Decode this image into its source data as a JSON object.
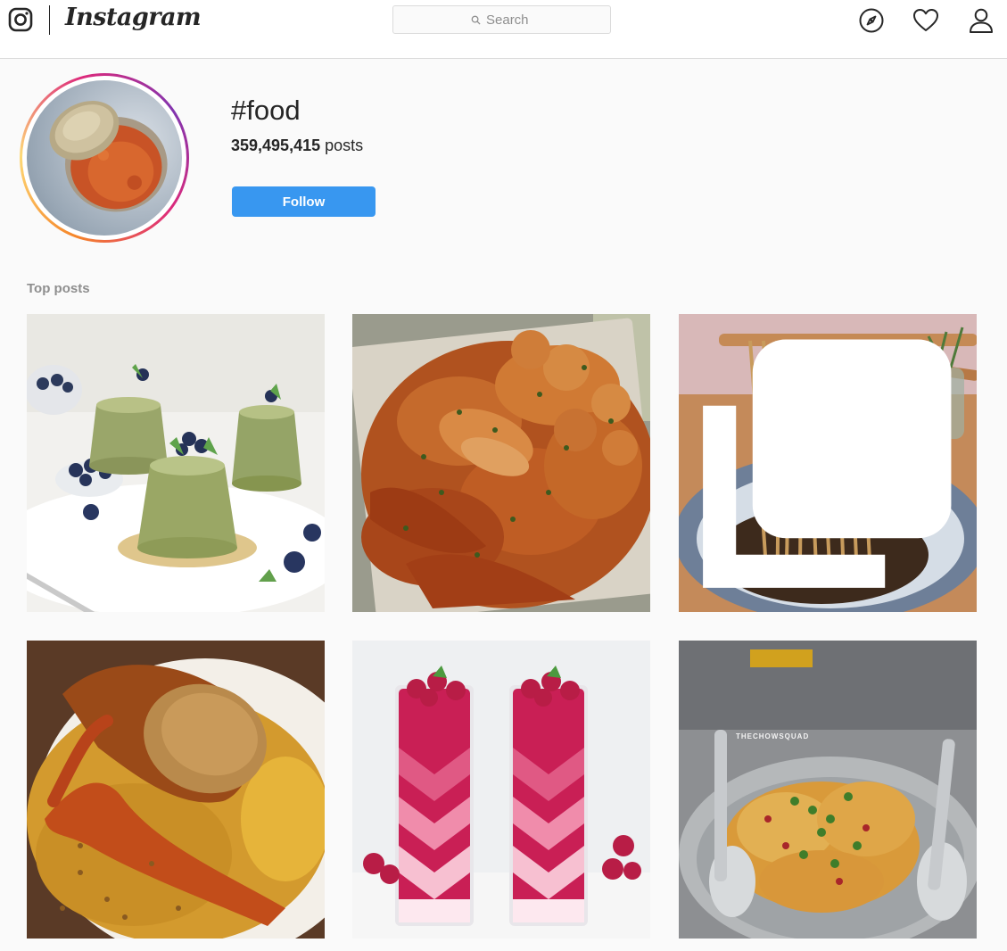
{
  "header": {
    "brand": "Instagram",
    "search_placeholder": "Search",
    "icons": [
      "instagram-glyph-icon",
      "search-icon",
      "explore-compass-icon",
      "activity-heart-icon",
      "profile-person-icon"
    ]
  },
  "hashtag": {
    "title": "#food",
    "post_count": "359,495,415",
    "post_count_suffix": "posts",
    "follow_label": "Follow"
  },
  "top_posts": {
    "label": "Top posts",
    "posts": [
      {
        "subject": "matcha panna cotta with blueberries"
      },
      {
        "subject": "seafood boil with shrimp and crawfish"
      },
      {
        "subject": "noodles lifted with chopsticks",
        "badge": "multiple-posts-icon"
      },
      {
        "subject": "lobster with saffron rice"
      },
      {
        "subject": "layered raspberry dessert glasses"
      },
      {
        "subject": "dahi puri street food plate",
        "watermark": "THECHOWSQUAD"
      }
    ]
  },
  "colors": {
    "follow_button": "#3897f0",
    "background": "#fafafa",
    "border": "#dbdbdb",
    "muted_text": "#8e8e8e"
  }
}
